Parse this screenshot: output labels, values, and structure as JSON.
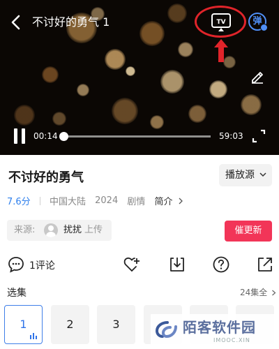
{
  "player": {
    "title": "不讨好的勇气 1",
    "tv_label": "TV",
    "danmu_label": "弹",
    "current_time": "00:14",
    "total_time": "59:03",
    "progress_fraction": 0.004
  },
  "info": {
    "show_title": "不讨好的勇气",
    "source_button_label": "播放源",
    "rating": "7.6分",
    "region": "中国大陆",
    "year": "2024",
    "genre": "剧情",
    "intro_label": "简介"
  },
  "source": {
    "label": "来源:",
    "uploader": "扰扰",
    "uploaded_label": "上传"
  },
  "urge_button_label": "催更新",
  "actions": {
    "comment_count_label": "1评论"
  },
  "episodes": {
    "label": "选集",
    "total_label": "24集全",
    "items": [
      {
        "label": "1",
        "active": true
      },
      {
        "label": "2",
        "active": false
      },
      {
        "label": "3",
        "active": false
      },
      {
        "label": "",
        "active": false
      },
      {
        "label": "",
        "active": false
      },
      {
        "label": "",
        "active": false
      }
    ]
  },
  "watermark": {
    "text": "陌客软件园",
    "sub": "IMOOC.XIN"
  },
  "colors": {
    "accent_blue": "#2f80ed",
    "urge_red": "#f23558",
    "highlight_red": "#e0242a"
  }
}
